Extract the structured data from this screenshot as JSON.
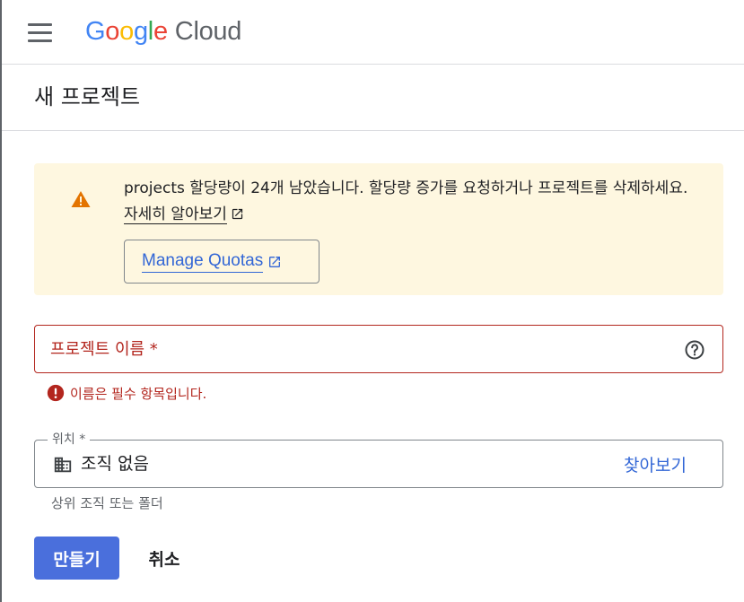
{
  "header": {
    "menu_icon": "hamburger-menu-icon",
    "logo": {
      "google": [
        "G",
        "o",
        "o",
        "g",
        "l",
        "e"
      ],
      "cloud": "Cloud"
    }
  },
  "page": {
    "title": "새 프로젝트"
  },
  "quota_alert": {
    "icon": "warning-icon",
    "text": "projects 할당량이 24개 남았습니다. 할당량 증가를 요청하거나 프로젝트를 삭제하세요.",
    "link_label": "자세히 알아보기",
    "button_label": "Manage Quotas",
    "colors": {
      "background": "#fef7e0",
      "icon": "#e37400"
    }
  },
  "project_name": {
    "placeholder": "프로젝트 이름 *",
    "value": "",
    "help_icon": "help-circle-icon",
    "error_icon": "error-icon",
    "error_text": "이름은 필수 항목입니다.",
    "error_color": "#b3261e"
  },
  "location": {
    "label": "위치 *",
    "icon": "organization-icon",
    "value": "조직 없음",
    "browse_label": "찾아보기",
    "hint": "상위 조직 또는 폴더"
  },
  "actions": {
    "create_label": "만들기",
    "cancel_label": "취소"
  },
  "colors": {
    "accent": "#3367d6",
    "primary_button": "#4a6fdc"
  }
}
